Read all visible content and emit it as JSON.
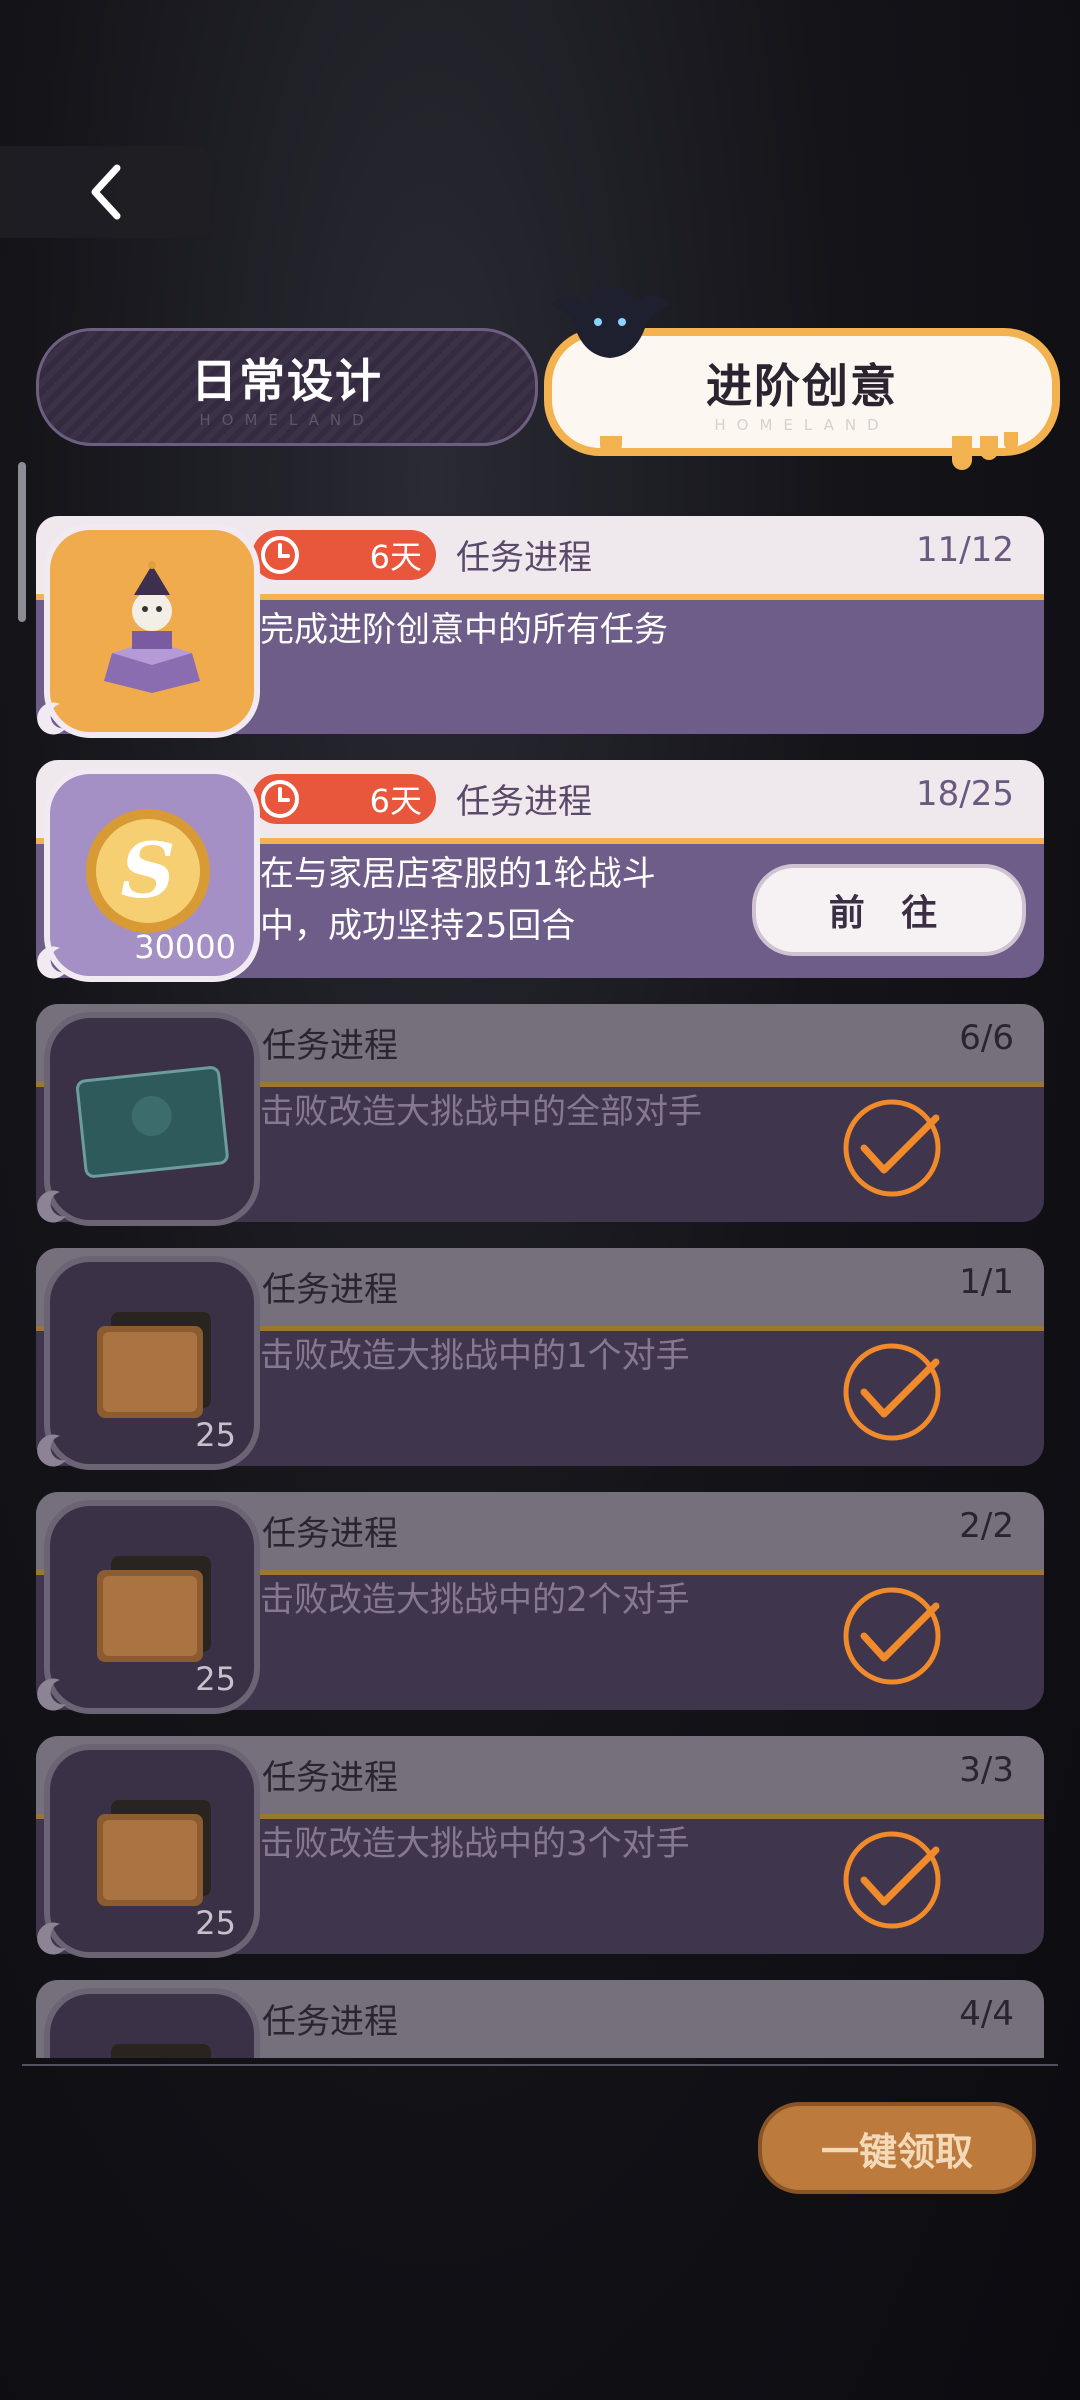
{
  "tabs": [
    {
      "label": "日常设计",
      "sub": "HOMELAND",
      "active": false
    },
    {
      "label": "进阶创意",
      "sub": "HOMELAND",
      "active": true
    }
  ],
  "tasks": [
    {
      "timer": "6天",
      "label": "任务进程",
      "progress": "11/12",
      "desc": "完成进阶创意中的所有任务",
      "reward_icon": "jack-in-the-box-icon",
      "status": "in-progress"
    },
    {
      "timer": "6天",
      "label": "任务进程",
      "progress": "18/25",
      "desc_line1": "在与家居店客服的1轮战斗",
      "desc_line2": "中，成功坚持25回合",
      "reward_icon": "coin-icon",
      "reward_amount": "30000",
      "button": "前 往",
      "status": "in-progress"
    },
    {
      "label": "任务进程",
      "progress": "6/6",
      "desc": "击败改造大挑战中的全部对手",
      "reward_icon": "card-icon",
      "status": "done"
    },
    {
      "label": "任务进程",
      "progress": "1/1",
      "desc": "击败改造大挑战中的1个对手",
      "reward_icon": "wood-plank-icon",
      "reward_amount": "25",
      "status": "done"
    },
    {
      "label": "任务进程",
      "progress": "2/2",
      "desc": "击败改造大挑战中的2个对手",
      "reward_icon": "wood-plank-icon",
      "reward_amount": "25",
      "status": "done"
    },
    {
      "label": "任务进程",
      "progress": "3/3",
      "desc": "击败改造大挑战中的3个对手",
      "reward_icon": "wood-plank-icon",
      "reward_amount": "25",
      "status": "done"
    },
    {
      "label": "任务进程",
      "progress": "4/4",
      "reward_icon": "wood-plank-icon",
      "status": "done"
    }
  ],
  "footer": {
    "claim_all": "一键领取"
  },
  "colors": {
    "accent": "#f1b24f",
    "timer": "#e8573b",
    "card": "#6f5d89",
    "check": "#f08a2a"
  }
}
